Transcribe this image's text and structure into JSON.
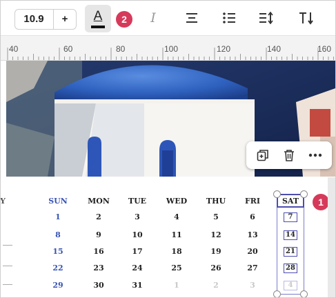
{
  "toolbar": {
    "font_size": "10.9",
    "increase_label": "+",
    "text_color_glyph": "A",
    "italic_glyph": "I",
    "badge_2": "2"
  },
  "ruler": {
    "labels": [
      "40",
      "60",
      "80",
      "100",
      "120",
      "140",
      "160"
    ]
  },
  "calendar": {
    "headers": [
      "SUN",
      "MON",
      "TUE",
      "WED",
      "THU",
      "FRI",
      "SAT"
    ],
    "rows": [
      [
        "1",
        "2",
        "3",
        "4",
        "5",
        "6",
        "7"
      ],
      [
        "8",
        "9",
        "10",
        "11",
        "12",
        "13",
        "14"
      ],
      [
        "15",
        "16",
        "17",
        "18",
        "19",
        "20",
        "21"
      ],
      [
        "22",
        "23",
        "24",
        "25",
        "26",
        "27",
        "28"
      ],
      [
        "29",
        "30",
        "31",
        "1",
        "2",
        "3",
        "4"
      ]
    ],
    "left_cut_char": "Y",
    "badge_1": "1"
  },
  "colors": {
    "accent_badge": "#d63a5a",
    "selection": "#4c4cb0",
    "sunday": "#3752b5"
  },
  "icons": [
    "text-color-icon",
    "italic-icon",
    "align-center-icon",
    "bullet-list-icon",
    "line-spacing-icon",
    "text-direction-icon",
    "duplicate-icon",
    "delete-icon",
    "more-icon"
  ]
}
